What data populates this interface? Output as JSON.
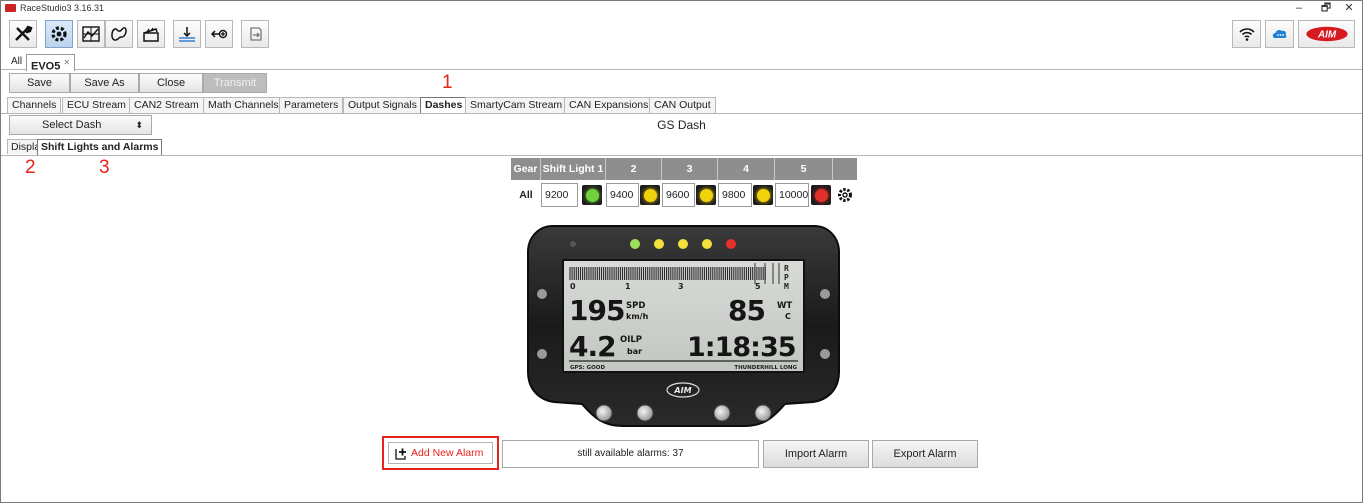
{
  "window": {
    "title": "RaceStudio3 3.16.31",
    "minimize": "–",
    "restore": "🗗",
    "close": "✕"
  },
  "toolbar": {
    "left_icons": [
      "wrench-screwdriver-icon",
      "settings-gear-icon",
      "analysis-chart-icon",
      "track-map-icon",
      "clapperboard-video-icon",
      "water-level-icon",
      "add-device-icon",
      "export-icon"
    ],
    "right_icons": [
      "wifi-icon",
      "cloud-icon",
      "aim-logo"
    ],
    "brand": "AIM"
  },
  "doc_tabs": {
    "all": "All",
    "active": "EVO5",
    "close_glyph": "✕"
  },
  "actions": {
    "save": "Save",
    "save_as": "Save As",
    "close": "Close",
    "transmit": "Transmit"
  },
  "config_tabs": [
    "Channels",
    "ECU Stream",
    "CAN2 Stream",
    "Math Channels",
    "Parameters",
    "Output Signals",
    "Dashes",
    "SmartyCam Stream",
    "CAN Expansions",
    "CAN Output"
  ],
  "active_config_tab": "Dashes",
  "select_dash": {
    "label": "Select Dash",
    "arrow": "⬍"
  },
  "dash_name": "GS Dash",
  "sub_tabs": {
    "display": "Display",
    "shift_lights": "Shift Lights and Alarms"
  },
  "markers": {
    "one": "1",
    "two": "2",
    "three": "3"
  },
  "shift_lights": {
    "headers": [
      "Gear",
      "Shift Light 1",
      "2",
      "3",
      "4",
      "5"
    ],
    "row_gear": "All",
    "values": [
      "9200",
      "9400",
      "9600",
      "9800",
      "10000"
    ],
    "led_colors": [
      "#6fd23a",
      "#f2d20b",
      "#f2d20b",
      "#f2d20b",
      "#e0302a"
    ]
  },
  "dash_display": {
    "rpm_label": "RPM",
    "rpm_ticks": [
      "0",
      "1",
      "3",
      "5"
    ],
    "speed": "195",
    "speed_label": "SPD",
    "speed_unit": "km/h",
    "water": "85",
    "water_label": "WT",
    "water_unit": "C",
    "oil": "4.2",
    "oil_label": "OILP",
    "oil_unit": "bar",
    "laptime": "1:18:35",
    "gps": "GPS: GOOD",
    "track": "THUNDERHILL LONG",
    "logo": "AIM",
    "top_leds": [
      "#9be05a",
      "#f4e03c",
      "#f4e03c",
      "#f4e03c",
      "#e8302a"
    ]
  },
  "alarms": {
    "add": "Add New Alarm",
    "available": "still available alarms: 37",
    "import": "Import Alarm",
    "export": "Export Alarm"
  }
}
